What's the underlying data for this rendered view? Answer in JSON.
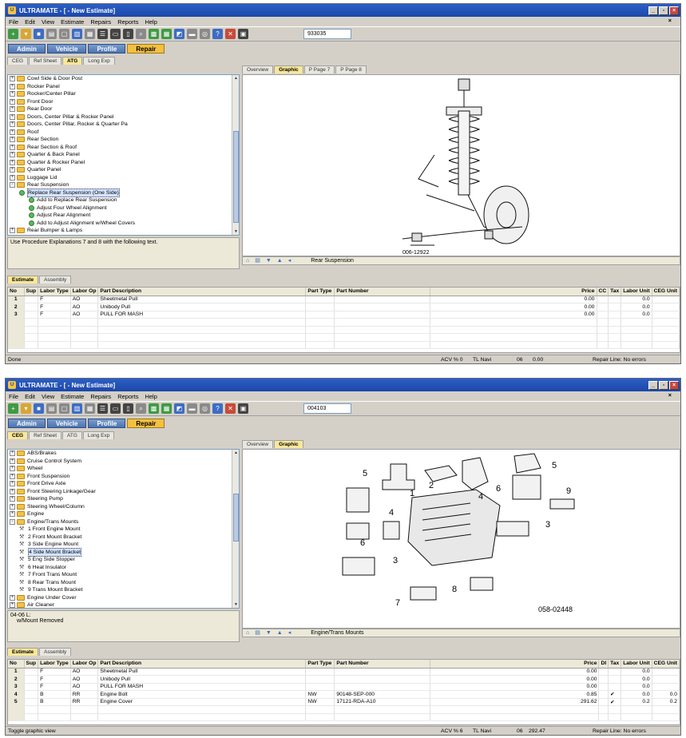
{
  "menu": [
    "File",
    "Edit",
    "View",
    "Estimate",
    "Repairs",
    "Reports",
    "Help"
  ],
  "nav_buttons": [
    "Admin",
    "Vehicle",
    "Profile",
    "Repair"
  ],
  "window1": {
    "title": "ULTRAMATE - [ - New Estimate]",
    "toolbar_input": "933035",
    "left_tabs": [
      "CEG",
      "Ref Sheet",
      "ATG",
      "Long Exp"
    ],
    "active_left_tab": "ATG",
    "tree": [
      {
        "label": "Cowl Side & Door Post",
        "kind": "folder",
        "level": 0
      },
      {
        "label": "Rocker Panel",
        "kind": "folder",
        "level": 0
      },
      {
        "label": "Rocker/Center Pillar",
        "kind": "folder",
        "level": 0
      },
      {
        "label": "Front Door",
        "kind": "folder",
        "level": 0
      },
      {
        "label": "Rear Door",
        "kind": "folder",
        "level": 0
      },
      {
        "label": "Doors, Center Pillar & Rocker Panel",
        "kind": "folder",
        "level": 0
      },
      {
        "label": "Doors, Center Pillar, Rocker & Quarter Pa",
        "kind": "folder",
        "level": 0
      },
      {
        "label": "Roof",
        "kind": "folder",
        "level": 0
      },
      {
        "label": "Rear Section",
        "kind": "folder",
        "level": 0
      },
      {
        "label": "Rear Section & Roof",
        "kind": "folder",
        "level": 0
      },
      {
        "label": "Quarter & Back Panel",
        "kind": "folder",
        "level": 0
      },
      {
        "label": "Quarter & Rocker Panel",
        "kind": "folder",
        "level": 0
      },
      {
        "label": "Quarter Panel",
        "kind": "folder",
        "level": 0
      },
      {
        "label": "Luggage Lid",
        "kind": "folder",
        "level": 0
      },
      {
        "label": "Rear Suspension",
        "kind": "folder-open",
        "level": 0
      },
      {
        "label": "Replace Rear Suspension (One Side)",
        "kind": "proc",
        "level": 1,
        "selected": true
      },
      {
        "label": "Add to Replace Rear Suspension",
        "kind": "proc",
        "level": 2
      },
      {
        "label": "Adjust Four Wheel Alignment",
        "kind": "proc",
        "level": 2
      },
      {
        "label": "Adjust Rear Alignment",
        "kind": "proc",
        "level": 2
      },
      {
        "label": "Add to Adjust Alignment w/Wheel Covers",
        "kind": "proc",
        "level": 2
      },
      {
        "label": "Rear Bumper & Lamps",
        "kind": "folder",
        "level": 0
      }
    ],
    "description": "Use Procedure Explanations 7 and 8 with the following text.",
    "graphic_tabs": [
      "Overview",
      "Graphic",
      "P Page 7",
      "P Page 8"
    ],
    "active_graphic_tab": "Graphic",
    "graphic_id": "006-12922",
    "graphic_caption": "Rear Suspension",
    "estimate_tabs": [
      "Estimate",
      "Assembly"
    ],
    "columns": [
      "No",
      "Sup",
      "Labor Type",
      "Labor Op",
      "Part Description",
      "Part Type",
      "Part Number",
      "Price",
      "CC",
      "Tax",
      "Labor Unit",
      "CEG Unit"
    ],
    "rows": [
      {
        "no": "1",
        "sup": "",
        "labor_type": "F",
        "labor_op": "AO",
        "desc": "Sheetmetal Pull",
        "part_type": "",
        "part_number": "",
        "price": "0.00",
        "cc": "",
        "tax": "",
        "labor_unit": "0.0",
        "ceg_unit": ""
      },
      {
        "no": "2",
        "sup": "",
        "labor_type": "F",
        "labor_op": "AO",
        "desc": "Unibody Pull",
        "part_type": "",
        "part_number": "",
        "price": "0.00",
        "cc": "",
        "tax": "",
        "labor_unit": "0.0",
        "ceg_unit": ""
      },
      {
        "no": "3",
        "sup": "",
        "labor_type": "F",
        "labor_op": "AO",
        "desc": "PULL FOR MASH",
        "part_type": "",
        "part_number": "",
        "price": "0.00",
        "cc": "",
        "tax": "",
        "labor_unit": "0.0",
        "ceg_unit": ""
      }
    ],
    "status": {
      "left": "Done",
      "acv": "ACV % 0",
      "tl": "TL Navi",
      "num": "06",
      "val": "0.00",
      "repair": "Repair Line: No errors"
    }
  },
  "window2": {
    "title": "ULTRAMATE - [ - New Estimate]",
    "toolbar_input": "004103",
    "left_tabs": [
      "CEG",
      "Ref Sheet",
      "ATG",
      "Long Exp"
    ],
    "active_left_tab": "CEG",
    "tree": [
      {
        "label": "ABS/Brakes",
        "kind": "folder",
        "level": 0
      },
      {
        "label": "Cruise Control System",
        "kind": "folder",
        "level": 0
      },
      {
        "label": "Wheel",
        "kind": "folder",
        "level": 0
      },
      {
        "label": "Front Suspension",
        "kind": "folder",
        "level": 0
      },
      {
        "label": "Front Drive Axle",
        "kind": "folder",
        "level": 0
      },
      {
        "label": "Front Steering Linkage/Gear",
        "kind": "folder",
        "level": 0
      },
      {
        "label": "Steering Pump",
        "kind": "folder",
        "level": 0
      },
      {
        "label": "Steering Wheel/Column",
        "kind": "folder",
        "level": 0
      },
      {
        "label": "Engine",
        "kind": "folder",
        "level": 0
      },
      {
        "label": "Engine/Trans Mounts",
        "kind": "folder-open",
        "level": 0
      },
      {
        "label": "1  Front Engine Mount",
        "kind": "part",
        "level": 1
      },
      {
        "label": "2  Front Mount Bracket",
        "kind": "part",
        "level": 1
      },
      {
        "label": "3  Side Engine Mount",
        "kind": "part",
        "level": 1
      },
      {
        "label": "4  Side Mount Bracket",
        "kind": "part",
        "level": 1,
        "selected": true
      },
      {
        "label": "5  Eng Side Stopper",
        "kind": "part",
        "level": 1
      },
      {
        "label": "6  Heat Insulator",
        "kind": "part",
        "level": 1
      },
      {
        "label": "7  Front Trans Mount",
        "kind": "part",
        "level": 1
      },
      {
        "label": "8  Rear Trans Mount",
        "kind": "part",
        "level": 1
      },
      {
        "label": "9  Trans Mount Bracket",
        "kind": "part",
        "level": 1
      },
      {
        "label": "Engine Under Cover",
        "kind": "folder",
        "level": 0
      },
      {
        "label": "Air Cleaner",
        "kind": "folder",
        "level": 0
      }
    ],
    "description_line1": "04-06  L:",
    "description_line2": "w/Mount Removed",
    "graphic_tabs": [
      "Overview",
      "Graphic"
    ],
    "active_graphic_tab": "Graphic",
    "graphic_id": "058-02448",
    "graphic_caption": "Engine/Trans Mounts",
    "callouts": [
      "1",
      "2",
      "3",
      "3",
      "4",
      "4",
      "5",
      "5",
      "6",
      "6",
      "7",
      "8",
      "9"
    ],
    "estimate_tabs": [
      "Estimate",
      "Assembly"
    ],
    "columns": [
      "No",
      "Sup",
      "Labor Type",
      "Labor Op",
      "Part Description",
      "Part Type",
      "Part Number",
      "Price",
      "DI",
      "Tax",
      "Labor Unit",
      "CEG Unit"
    ],
    "rows": [
      {
        "no": "1",
        "sup": "",
        "labor_type": "F",
        "labor_op": "AO",
        "desc": "Sheetmetal Pull",
        "part_type": "",
        "part_number": "",
        "price": "0.00",
        "cc": "",
        "tax": "",
        "labor_unit": "0.0",
        "ceg_unit": ""
      },
      {
        "no": "2",
        "sup": "",
        "labor_type": "F",
        "labor_op": "AO",
        "desc": "Unibody Pull",
        "part_type": "",
        "part_number": "",
        "price": "0.00",
        "cc": "",
        "tax": "",
        "labor_unit": "0.0",
        "ceg_unit": ""
      },
      {
        "no": "3",
        "sup": "",
        "labor_type": "F",
        "labor_op": "AO",
        "desc": "PULL FOR MASH",
        "part_type": "",
        "part_number": "",
        "price": "0.00",
        "cc": "",
        "tax": "",
        "labor_unit": "0.0",
        "ceg_unit": ""
      },
      {
        "no": "4",
        "sup": "",
        "labor_type": "B",
        "labor_op": "RR",
        "desc": "Engine Bolt",
        "part_type": "NW",
        "part_number": "90148-SEP-000",
        "price": "0.85",
        "cc": "",
        "tax": "✔",
        "labor_unit": "0.0",
        "ceg_unit": "0.0"
      },
      {
        "no": "5",
        "sup": "",
        "labor_type": "B",
        "labor_op": "RR",
        "desc": "Engine Cover",
        "part_type": "NW",
        "part_number": "17121-RDA-A10",
        "price": "291.62",
        "cc": "",
        "tax": "✔",
        "labor_unit": "0.2",
        "ceg_unit": "0.2"
      }
    ],
    "status": {
      "left": "Toggle graphic view",
      "acv": "ACV % 6",
      "tl": "TL Navi",
      "num": "06",
      "val": "292.47",
      "repair": "Repair Line: No errors"
    }
  },
  "colors": {
    "titlebar": "#1c47a8",
    "active_nav": "#f4c040",
    "active_tab": "#f9e79a",
    "chrome": "#d4d0c8"
  }
}
